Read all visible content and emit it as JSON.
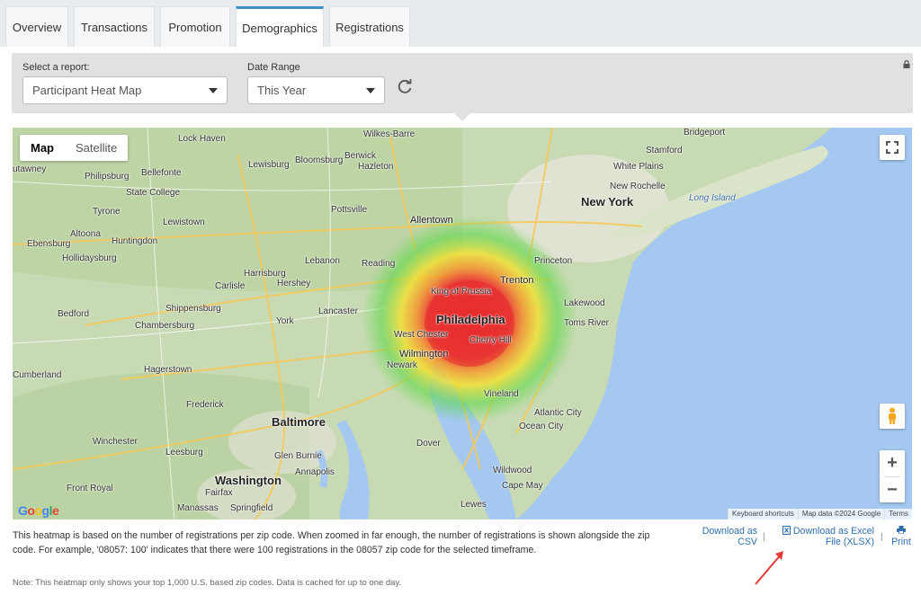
{
  "tabs": [
    {
      "label": "Overview",
      "active": false
    },
    {
      "label": "Transactions",
      "active": false
    },
    {
      "label": "Promotion",
      "active": false
    },
    {
      "label": "Demographics",
      "active": true
    },
    {
      "label": "Registrations",
      "active": false
    }
  ],
  "filters": {
    "report_label": "Select a report:",
    "report_value": "Participant Heat Map",
    "range_label": "Date Range",
    "range_value": "This Year"
  },
  "map": {
    "type_map": "Map",
    "type_satellite": "Satellite",
    "zoom_in": "+",
    "zoom_out": "−",
    "credits": {
      "shortcuts": "Keyboard shortcuts",
      "data": "Map data ©2024 Google",
      "terms": "Terms"
    },
    "google_logo": "Google",
    "colors": {
      "land": "#c8dab3",
      "water": "#a4c8f0",
      "heat_hot": "#e8262a",
      "heat_warm": "#f4e12e",
      "heat_cool": "#5fd84a",
      "road": "#f5c95a"
    },
    "labels": {
      "wilkes_barre": "Wilkes-Barre",
      "bridgeport": "Bridgeport",
      "lock_haven": "Lock Haven",
      "stamford": "Stamford",
      "utawney": "utawney",
      "bloomsburg": "Bloomsburg",
      "berwick": "Berwick",
      "hazleton": "Hazleton",
      "white_plains": "White Plains",
      "philipsburg": "Philipsburg",
      "bellefonte": "Bellefonte",
      "lewisburg": "Lewisburg",
      "new_rochelle": "New Rochelle",
      "state_college": "State College",
      "new_york": "New York",
      "long_island": "Long Island",
      "tyrone": "Tyrone",
      "pottsville": "Pottsville",
      "lewistown": "Lewistown",
      "allentown": "Allentown",
      "ebensburg": "Ebensburg",
      "altoona": "Altoona",
      "huntingdon": "Huntingdon",
      "hollidaysburg": "Hollidaysburg",
      "lebanon": "Lebanon",
      "reading": "Reading",
      "harrisburg": "Harrisburg",
      "carlisle": "Carlisle",
      "hershey": "Hershey",
      "princeton": "Princeton",
      "trenton": "Trenton",
      "king_of_prussia": "King of Prussia",
      "lakewood": "Lakewood",
      "bedford": "Bedford",
      "shippensburg": "Shippensburg",
      "lancaster": "Lancaster",
      "philadelphia": "Philadelphia",
      "chambersburg": "Chambersburg",
      "york": "York",
      "toms_river": "Toms River",
      "west_chester": "West Chester",
      "cherry_hill": "Cherry Hill",
      "wilmington": "Wilmington",
      "newark": "Newark",
      "cumberland": "Cumberland",
      "hagerstown": "Hagerstown",
      "vineland": "Vineland",
      "frederick": "Frederick",
      "baltimore": "Baltimore",
      "atlantic_city": "Atlantic City",
      "ocean_city": "Ocean City",
      "winchester": "Winchester",
      "dover": "Dover",
      "leesburg": "Leesburg",
      "glen_burnie": "Glen Burnie",
      "annapolis": "Annapolis",
      "wildwood": "Wildwood",
      "washington": "Washington",
      "cape_may": "Cape May",
      "front_royal": "Front Royal",
      "fairfax": "Fairfax",
      "manassas": "Manassas",
      "springfield": "Springfield",
      "lewes": "Lewes"
    }
  },
  "description": "This heatmap is based on the number of registrations per zip code. When zoomed in far enough, the number of registrations is shown alongside the zip code. For example, '08057: 100' indicates that there were 100 registrations in the 08057 zip code for the selected timeframe.",
  "note": "Note: This heatmap only shows your top 1,000 U.S. based zip codes. Data is cached for up to one day.",
  "downloads": {
    "csv_line1": "Download as",
    "csv_line2": "CSV",
    "xlsx_line1": "Download as Excel",
    "xlsx_line2": "File (XLSX)",
    "print": "Print",
    "separator": "|"
  }
}
